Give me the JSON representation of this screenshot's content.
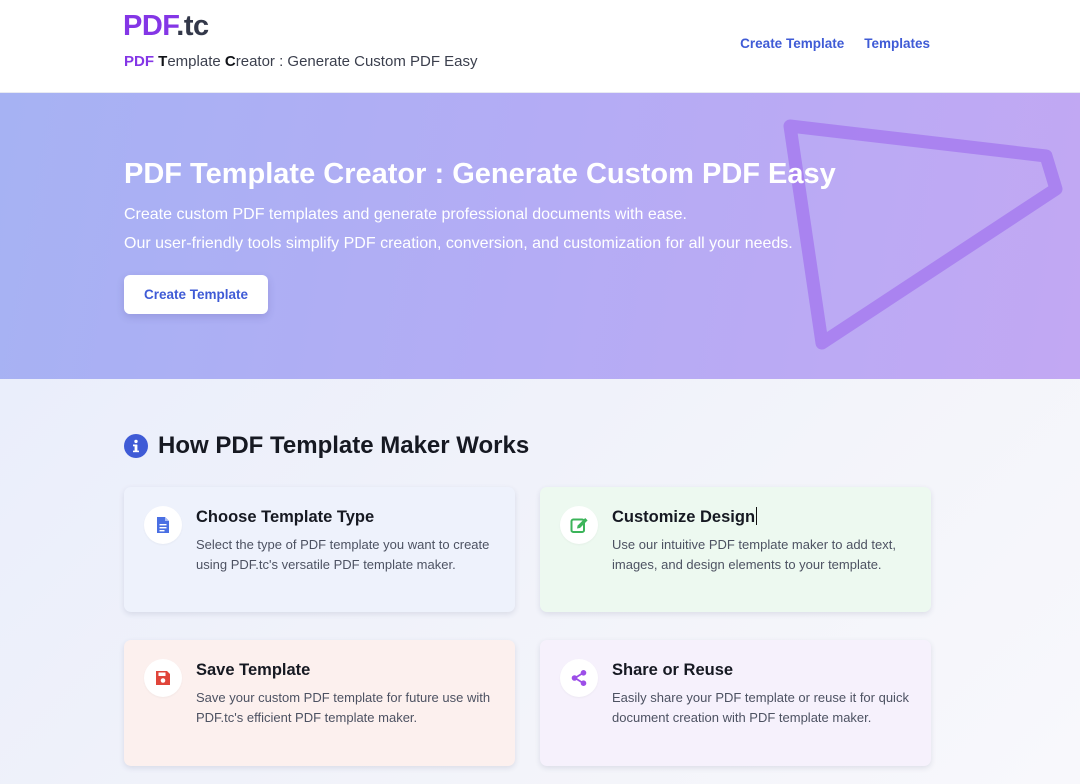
{
  "header": {
    "logo_main": "PDF",
    "logo_suffix": ".tc",
    "tagline": {
      "w1_bold": "PDF",
      "w2_bold": "T",
      "w2_rest": "emplate ",
      "w3_bold": "C",
      "w3_rest": "reator : Generate Custom PDF Easy"
    },
    "nav": [
      {
        "label": "Create Template"
      },
      {
        "label": "Templates"
      }
    ]
  },
  "hero": {
    "title": "PDF Template Creator : Generate Custom PDF Easy",
    "line1": "Create custom PDF templates and generate professional documents with ease.",
    "line2": "Our user-friendly tools simplify PDF creation, conversion, and customization for all your needs.",
    "button_label": "Create Template"
  },
  "section": {
    "title": "How PDF Template Maker Works",
    "icon": "info-circle-icon",
    "cards": [
      {
        "title": "Choose Template Type",
        "desc": "Select the type of PDF template you want to create using PDF.tc's versatile PDF template maker.",
        "icon": "document-icon",
        "color": "#4a6fe3"
      },
      {
        "title": "Customize Design",
        "desc": "Use our intuitive PDF template maker to add text, images, and design elements to your template.",
        "icon": "edit-icon",
        "color": "#3cb45a"
      },
      {
        "title": "Save Template",
        "desc": "Save your custom PDF template for future use with PDF.tc's efficient PDF template maker.",
        "icon": "save-icon",
        "color": "#e0453a"
      },
      {
        "title": "Share or Reuse",
        "desc": "Easily share your PDF template or reuse it for quick document creation with PDF template maker.",
        "icon": "share-icon",
        "color": "#9c4ee8"
      }
    ]
  },
  "colors": {
    "brand_purple": "#8436e6",
    "link_blue": "#3f5bd6"
  }
}
